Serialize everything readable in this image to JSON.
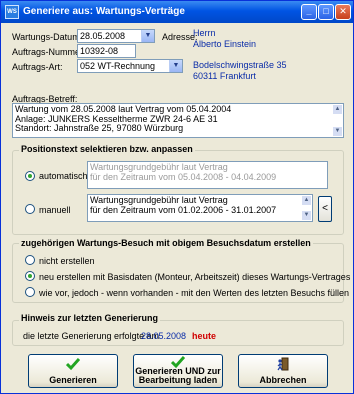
{
  "window": {
    "icon_text": "WS",
    "title": "Generiere aus: Wartungs-Verträge",
    "controls": {
      "minimize": "_",
      "maximize": "□",
      "close": "✕"
    }
  },
  "form": {
    "datum_label": "Wartungs-Datum:",
    "datum_value": "28.05.2008",
    "auftragsnr_label": "Auftrags-Nummer:",
    "auftragsnr_value": "10392-08",
    "auftragsart_label": "Auftrags-Art:",
    "auftragsart_value": "052 WT-Rechnung",
    "adresse_label": "Adresse:",
    "adresse_lines": [
      "Herrn",
      "Alberto Einstein",
      "Bodelschwingstraße 35",
      "60311 Frankfurt"
    ],
    "betreff_label": "Auftrags-Betreff:",
    "betreff_lines": [
      "Wartung vom 28.05.2008 laut Vertrag vom 05.04.2004",
      "Anlage:   JUNKERS Kesseltherme ZWR 24-6 AE 31",
      "Standort: Jahnstraße 25, 97080 Würzburg"
    ]
  },
  "positionstext": {
    "title": "Positionstext selektieren bzw. anpassen",
    "automatisch_label": "automatisch",
    "automatisch_lines": [
      "Wartungsgrundgebühr laut Vertrag",
      "für den Zeitraum vom 05.04.2008 - 04.04.2009"
    ],
    "manuell_label": "manuell",
    "manuell_lines": [
      "Wartungsgrundgebühr laut Vertrag",
      "für den Zeitraum vom 01.02.2006 - 31.01.2007"
    ],
    "arrow_label": "<"
  },
  "besuch": {
    "title": "zugehörigen Wartungs-Besuch mit obigem Besuchsdatum erstellen",
    "options": [
      "nicht erstellen",
      "neu erstellen mit Basisdaten (Monteur, Arbeitszeit) dieses Wartungs-Vertrages",
      "wie vor, jedoch - wenn vorhanden - mit den Werten des letzten Besuchs füllen"
    ],
    "selected_index": 1
  },
  "hinweis": {
    "title": "Hinweis zur letzten Generierung",
    "text": "die letzte Generierung erfolgte am",
    "date": "28.05.2008",
    "heute": "heute"
  },
  "buttons": {
    "generieren": "Generieren",
    "generieren_und_line1": "Generieren UND zur",
    "generieren_und_line2": "Bearbeitung laden",
    "abbrechen": "Abbrechen"
  },
  "colors": {
    "accent_blue": "#0b2da8",
    "highlight_red": "#d00000",
    "check_green": "#22a522"
  }
}
